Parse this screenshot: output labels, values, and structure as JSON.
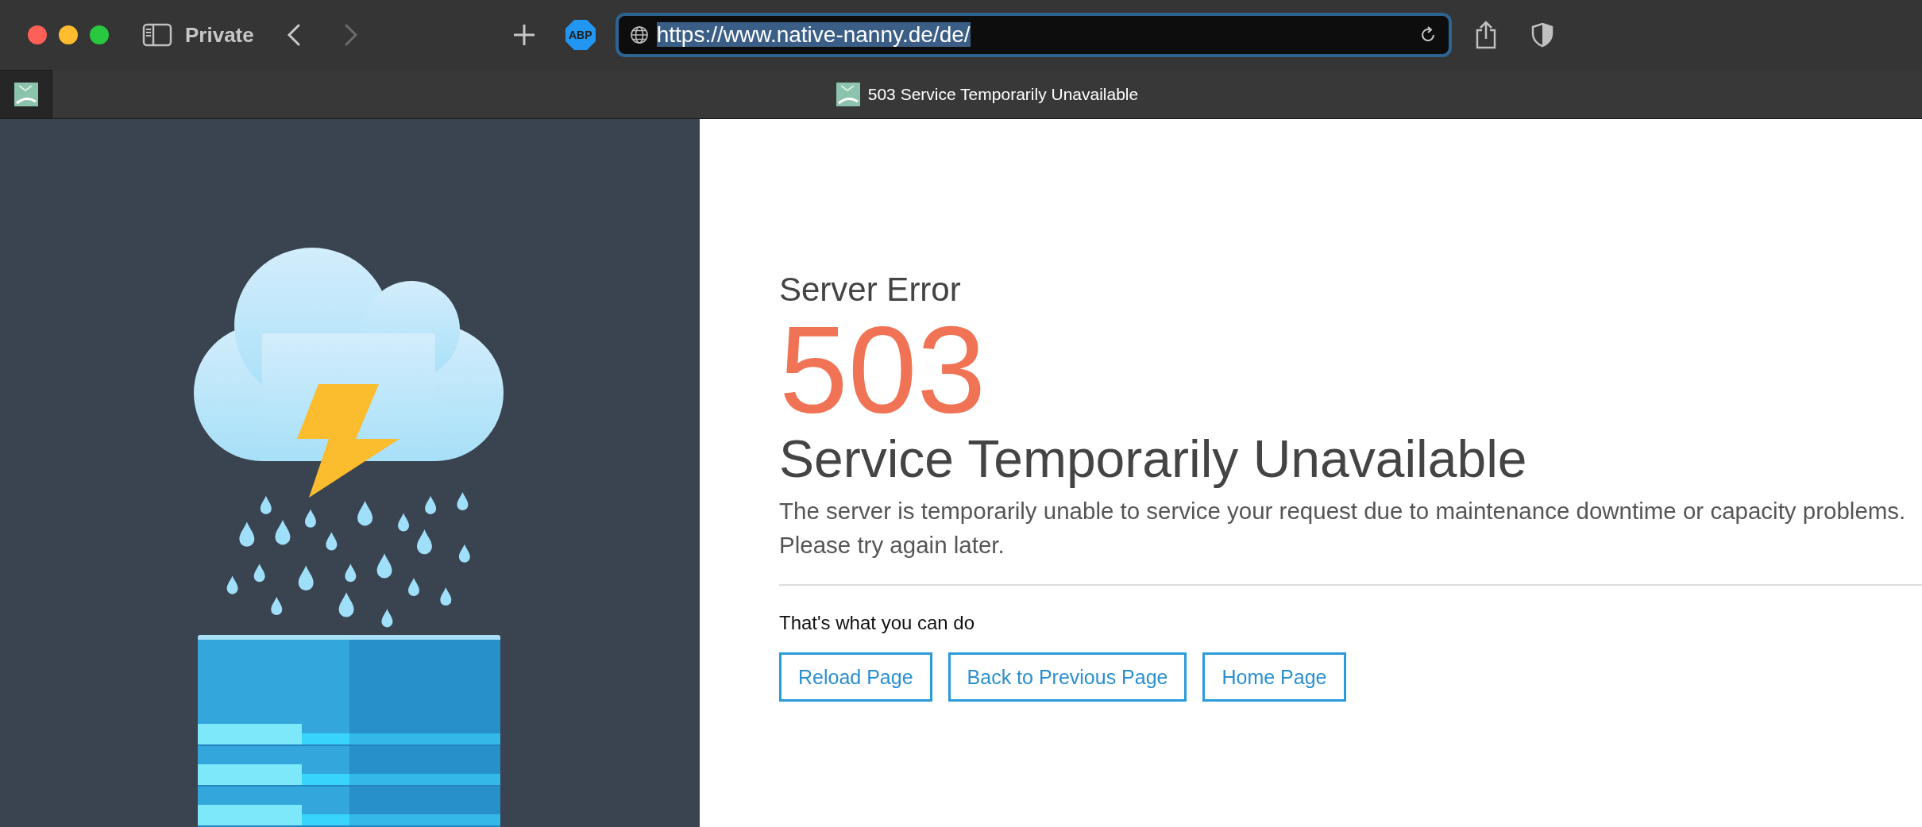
{
  "toolbar": {
    "tab_group": "Private",
    "back": {
      "disabled": false
    },
    "forward": {
      "disabled": true
    },
    "extension_badge": "ABP",
    "address": {
      "value": "https://www.native-nanny.de/de/",
      "text_selected": true
    }
  },
  "tabs": [
    {
      "kind": "pinned",
      "selected": false
    },
    {
      "kind": "normal",
      "title": "503 Service Temporarily Unavailable",
      "selected": true
    }
  ],
  "page": {
    "heading": "Server Error",
    "code": "503",
    "title": "Service Temporarily Unavailable",
    "message": "The server is temporarily unable to service your request due to maintenance downtime or capacity problems. Please try again later.",
    "actions_heading": "That's what you can do",
    "buttons": [
      "Reload Page",
      "Back to Previous Page",
      "Home Page"
    ]
  }
}
